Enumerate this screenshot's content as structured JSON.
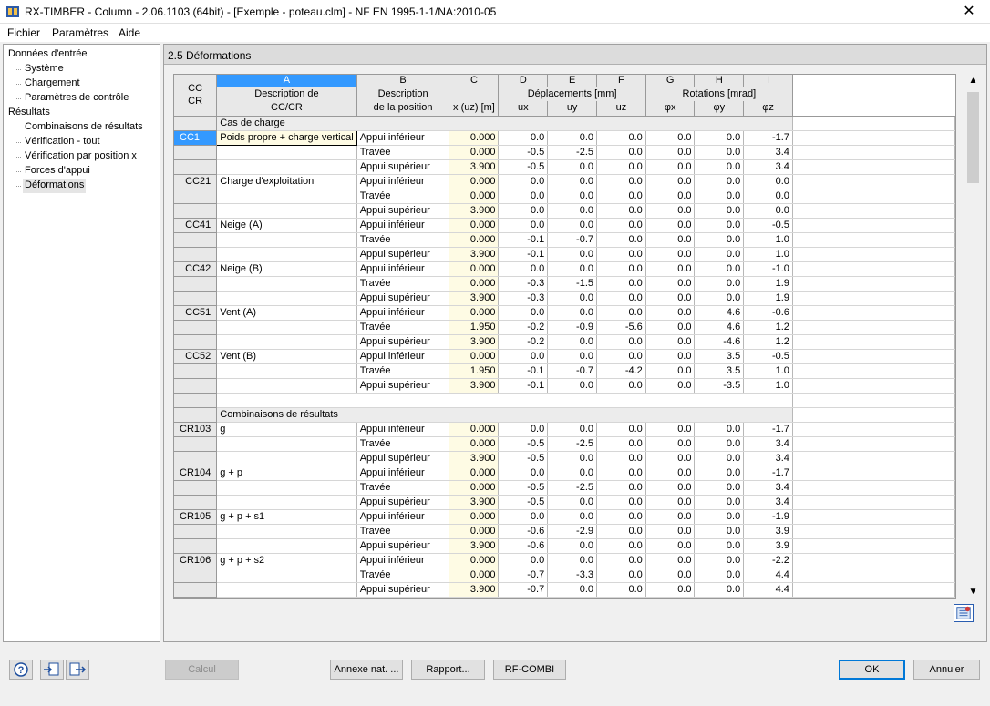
{
  "window": {
    "title": "RX-TIMBER - Column - 2.06.1103 (64bit) - [Exemple - poteau.clm] - NF EN 1995-1-1/NA:2010-05",
    "close_glyph": "✕"
  },
  "menu": [
    "Fichier",
    "Paramètres",
    "Aide"
  ],
  "tree": {
    "input_root": "Données d'entrée",
    "input_items": [
      "Système",
      "Chargement",
      "Paramètres de contrôle"
    ],
    "results_root": "Résultats",
    "results_items": [
      "Combinaisons de résultats",
      "Vérification - tout",
      "Vérification par position x",
      "Forces d'appui",
      "Déformations"
    ],
    "selected": "Déformations"
  },
  "panel": {
    "title": "2.5 Déformations"
  },
  "table": {
    "corner": [
      "CC",
      "CR"
    ],
    "columns": [
      {
        "letter": "A",
        "h1": "Description de",
        "h2": "CC/CR"
      },
      {
        "letter": "B",
        "h1": "Description",
        "h2": "de la position"
      },
      {
        "letter": "C",
        "h1": "",
        "h2": "x (uz) [m]"
      },
      {
        "letter": "D",
        "h1": "",
        "h2": "ux"
      },
      {
        "letter": "E",
        "h1": "Déplacements [mm]",
        "h2": "uy"
      },
      {
        "letter": "F",
        "h1": "",
        "h2": "uz"
      },
      {
        "letter": "G",
        "h1": "",
        "h2": "φx"
      },
      {
        "letter": "H",
        "h1": "Rotations [mrad]",
        "h2": "φy"
      },
      {
        "letter": "I",
        "h1": "",
        "h2": "φz"
      }
    ],
    "rows": [
      {
        "type": "section",
        "label": "Cas de charge"
      },
      {
        "id": "CC1",
        "desc": "Poids propre + charge vertical",
        "pos": "Appui inférieur",
        "v": [
          "0.000",
          "0.0",
          "0.0",
          "0.0",
          "0.0",
          "0.0",
          "-1.7"
        ],
        "selected": true
      },
      {
        "id": "",
        "desc": "",
        "pos": "Travée",
        "v": [
          "0.000",
          "-0.5",
          "-2.5",
          "0.0",
          "0.0",
          "0.0",
          "3.4"
        ]
      },
      {
        "id": "",
        "desc": "",
        "pos": "Appui supérieur",
        "v": [
          "3.900",
          "-0.5",
          "0.0",
          "0.0",
          "0.0",
          "0.0",
          "3.4"
        ]
      },
      {
        "id": "CC21",
        "desc": "Charge d'exploitation",
        "pos": "Appui inférieur",
        "v": [
          "0.000",
          "0.0",
          "0.0",
          "0.0",
          "0.0",
          "0.0",
          "0.0"
        ]
      },
      {
        "id": "",
        "desc": "",
        "pos": "Travée",
        "v": [
          "0.000",
          "0.0",
          "0.0",
          "0.0",
          "0.0",
          "0.0",
          "0.0"
        ]
      },
      {
        "id": "",
        "desc": "",
        "pos": "Appui supérieur",
        "v": [
          "3.900",
          "0.0",
          "0.0",
          "0.0",
          "0.0",
          "0.0",
          "0.0"
        ]
      },
      {
        "id": "CC41",
        "desc": "Neige (A)",
        "pos": "Appui inférieur",
        "v": [
          "0.000",
          "0.0",
          "0.0",
          "0.0",
          "0.0",
          "0.0",
          "-0.5"
        ]
      },
      {
        "id": "",
        "desc": "",
        "pos": "Travée",
        "v": [
          "0.000",
          "-0.1",
          "-0.7",
          "0.0",
          "0.0",
          "0.0",
          "1.0"
        ]
      },
      {
        "id": "",
        "desc": "",
        "pos": "Appui supérieur",
        "v": [
          "3.900",
          "-0.1",
          "0.0",
          "0.0",
          "0.0",
          "0.0",
          "1.0"
        ]
      },
      {
        "id": "CC42",
        "desc": "Neige (B)",
        "pos": "Appui inférieur",
        "v": [
          "0.000",
          "0.0",
          "0.0",
          "0.0",
          "0.0",
          "0.0",
          "-1.0"
        ]
      },
      {
        "id": "",
        "desc": "",
        "pos": "Travée",
        "v": [
          "0.000",
          "-0.3",
          "-1.5",
          "0.0",
          "0.0",
          "0.0",
          "1.9"
        ]
      },
      {
        "id": "",
        "desc": "",
        "pos": "Appui supérieur",
        "v": [
          "3.900",
          "-0.3",
          "0.0",
          "0.0",
          "0.0",
          "0.0",
          "1.9"
        ]
      },
      {
        "id": "CC51",
        "desc": "Vent (A)",
        "pos": "Appui inférieur",
        "v": [
          "0.000",
          "0.0",
          "0.0",
          "0.0",
          "0.0",
          "4.6",
          "-0.6"
        ]
      },
      {
        "id": "",
        "desc": "",
        "pos": "Travée",
        "v": [
          "1.950",
          "-0.2",
          "-0.9",
          "-5.6",
          "0.0",
          "4.6",
          "1.2"
        ]
      },
      {
        "id": "",
        "desc": "",
        "pos": "Appui supérieur",
        "v": [
          "3.900",
          "-0.2",
          "0.0",
          "0.0",
          "0.0",
          "-4.6",
          "1.2"
        ]
      },
      {
        "id": "CC52",
        "desc": "Vent (B)",
        "pos": "Appui inférieur",
        "v": [
          "0.000",
          "0.0",
          "0.0",
          "0.0",
          "0.0",
          "3.5",
          "-0.5"
        ]
      },
      {
        "id": "",
        "desc": "",
        "pos": "Travée",
        "v": [
          "1.950",
          "-0.1",
          "-0.7",
          "-4.2",
          "0.0",
          "3.5",
          "1.0"
        ]
      },
      {
        "id": "",
        "desc": "",
        "pos": "Appui supérieur",
        "v": [
          "3.900",
          "-0.1",
          "0.0",
          "0.0",
          "0.0",
          "-3.5",
          "1.0"
        ]
      },
      {
        "type": "blank"
      },
      {
        "type": "section",
        "label": "Combinaisons de résultats"
      },
      {
        "id": "CR103",
        "desc": "g",
        "pos": "Appui inférieur",
        "v": [
          "0.000",
          "0.0",
          "0.0",
          "0.0",
          "0.0",
          "0.0",
          "-1.7"
        ]
      },
      {
        "id": "",
        "desc": "",
        "pos": "Travée",
        "v": [
          "0.000",
          "-0.5",
          "-2.5",
          "0.0",
          "0.0",
          "0.0",
          "3.4"
        ]
      },
      {
        "id": "",
        "desc": "",
        "pos": "Appui supérieur",
        "v": [
          "3.900",
          "-0.5",
          "0.0",
          "0.0",
          "0.0",
          "0.0",
          "3.4"
        ]
      },
      {
        "id": "CR104",
        "desc": "g + p",
        "pos": "Appui inférieur",
        "v": [
          "0.000",
          "0.0",
          "0.0",
          "0.0",
          "0.0",
          "0.0",
          "-1.7"
        ]
      },
      {
        "id": "",
        "desc": "",
        "pos": "Travée",
        "v": [
          "0.000",
          "-0.5",
          "-2.5",
          "0.0",
          "0.0",
          "0.0",
          "3.4"
        ]
      },
      {
        "id": "",
        "desc": "",
        "pos": "Appui supérieur",
        "v": [
          "3.900",
          "-0.5",
          "0.0",
          "0.0",
          "0.0",
          "0.0",
          "3.4"
        ]
      },
      {
        "id": "CR105",
        "desc": "g + p + s1",
        "pos": "Appui inférieur",
        "v": [
          "0.000",
          "0.0",
          "0.0",
          "0.0",
          "0.0",
          "0.0",
          "-1.9"
        ]
      },
      {
        "id": "",
        "desc": "",
        "pos": "Travée",
        "v": [
          "0.000",
          "-0.6",
          "-2.9",
          "0.0",
          "0.0",
          "0.0",
          "3.9"
        ]
      },
      {
        "id": "",
        "desc": "",
        "pos": "Appui supérieur",
        "v": [
          "3.900",
          "-0.6",
          "0.0",
          "0.0",
          "0.0",
          "0.0",
          "3.9"
        ]
      },
      {
        "id": "CR106",
        "desc": "g + p + s2",
        "pos": "Appui inférieur",
        "v": [
          "0.000",
          "0.0",
          "0.0",
          "0.0",
          "0.0",
          "0.0",
          "-2.2"
        ]
      },
      {
        "id": "",
        "desc": "",
        "pos": "Travée",
        "v": [
          "0.000",
          "-0.7",
          "-3.3",
          "0.0",
          "0.0",
          "0.0",
          "4.4"
        ]
      },
      {
        "id": "",
        "desc": "",
        "pos": "Appui supérieur",
        "v": [
          "3.900",
          "-0.7",
          "0.0",
          "0.0",
          "0.0",
          "0.0",
          "4.4"
        ]
      }
    ]
  },
  "buttons": {
    "calc": "Calcul",
    "annex": "Annexe nat. ...",
    "report": "Rapport...",
    "rfcombi": "RF-COMBI",
    "ok": "OK",
    "cancel": "Annuler"
  },
  "icons": [
    "app-icon",
    "help-icon",
    "import-icon",
    "export-icon",
    "excel-export-icon"
  ],
  "colors": {
    "selection": "#3399ff",
    "editable_cell": "#fefbe4",
    "header_bg": "#e8e8e8",
    "panel_header": "#dcdcdc"
  }
}
